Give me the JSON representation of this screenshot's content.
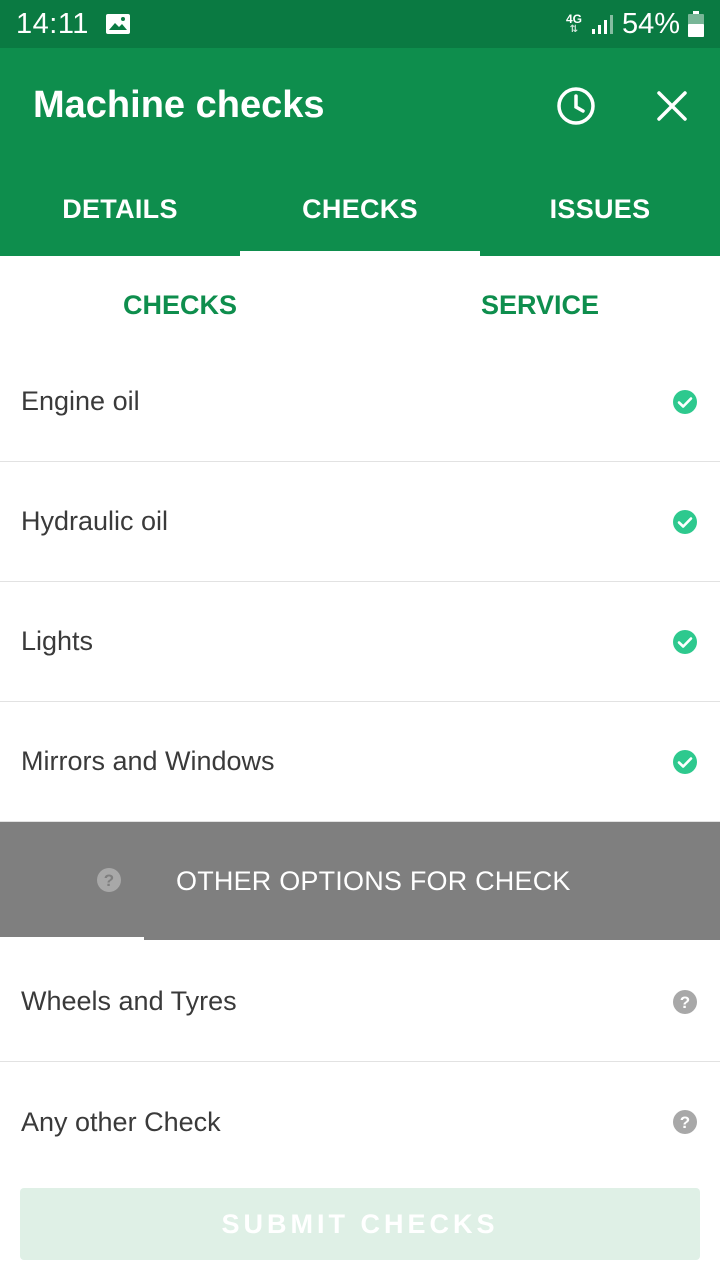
{
  "status_bar": {
    "time": "14:11",
    "network": "4G",
    "battery": "54%",
    "icons": [
      "image-icon",
      "signal-icon",
      "battery-icon"
    ]
  },
  "app_bar": {
    "title": "Machine checks",
    "history_icon": "history-clock-icon",
    "close_icon": "close-icon",
    "color": "#0e8e4d"
  },
  "main_tabs": [
    {
      "label": "DETAILS",
      "active": false
    },
    {
      "label": "CHECKS",
      "active": true
    },
    {
      "label": "ISSUES",
      "active": false
    }
  ],
  "sub_tabs": [
    {
      "label": "CHECKS",
      "active": true
    },
    {
      "label": "SERVICE",
      "active": false
    }
  ],
  "checks": [
    {
      "label": "Engine oil",
      "status": "check-circle-icon"
    },
    {
      "label": "Hydraulic oil",
      "status": "check-circle-icon"
    },
    {
      "label": "Lights",
      "status": "check-circle-icon"
    },
    {
      "label": "Mirrors and Windows",
      "status": "check-circle-icon"
    }
  ],
  "other_options": {
    "title": "OTHER OPTIONS FOR CHECK",
    "icon": "help-circle-icon"
  },
  "pending_checks": [
    {
      "label": "Wheels and Tyres",
      "status": "help-circle-icon"
    },
    {
      "label": "Any other Check",
      "status": "help-circle-icon"
    }
  ],
  "submit": {
    "label": "SUBMIT CHECKS",
    "enabled": false
  },
  "colors": {
    "status_bar": "#0a7a42",
    "accent": "#0e8e4d",
    "check_ok": "#2ec98e",
    "help_grey": "#a8a8a8",
    "banner": "#7f7f7f"
  }
}
